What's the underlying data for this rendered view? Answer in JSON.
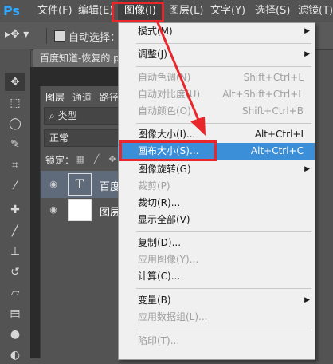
{
  "app": {
    "logo": "Ps"
  },
  "menubar": {
    "items": [
      {
        "label": "文件(F)"
      },
      {
        "label": "编辑(E)"
      },
      {
        "label": "图像(I)"
      },
      {
        "label": "图层(L)"
      },
      {
        "label": "文字(Y)"
      },
      {
        "label": "选择(S)"
      },
      {
        "label": "滤镜(T)"
      }
    ]
  },
  "options_bar": {
    "auto_select_label": "自动选择："
  },
  "document": {
    "tab_title": "百度知道-恢复的.p"
  },
  "layers_panel": {
    "tabs": [
      "图层",
      "通道",
      "路径"
    ],
    "filter_label": "类型",
    "blend_mode": "正常",
    "lock_label": "锁定：",
    "layers": [
      {
        "thumb_text": "T",
        "name": "百度"
      },
      {
        "name": "图层"
      }
    ]
  },
  "dropdown": {
    "items": [
      {
        "label": "模式(M)",
        "shortcut": "",
        "submenu": true,
        "disabled": false
      },
      {
        "label": "调整(J)",
        "shortcut": "",
        "submenu": true,
        "disabled": false
      },
      {
        "label": "自动色调(N)",
        "shortcut": "Shift+Ctrl+L",
        "submenu": false,
        "disabled": true
      },
      {
        "label": "自动对比度(U)",
        "shortcut": "Alt+Shift+Ctrl+L",
        "submenu": false,
        "disabled": true
      },
      {
        "label": "自动颜色(O)",
        "shortcut": "Shift+Ctrl+B",
        "submenu": false,
        "disabled": true
      },
      {
        "label": "图像大小(I)...",
        "shortcut": "Alt+Ctrl+I",
        "submenu": false,
        "disabled": false
      },
      {
        "label": "画布大小(S)...",
        "shortcut": "Alt+Ctrl+C",
        "submenu": false,
        "disabled": false,
        "highlighted": true
      },
      {
        "label": "图像旋转(G)",
        "shortcut": "",
        "submenu": true,
        "disabled": false
      },
      {
        "label": "裁剪(P)",
        "shortcut": "",
        "submenu": false,
        "disabled": true
      },
      {
        "label": "裁切(R)...",
        "shortcut": "",
        "submenu": false,
        "disabled": false
      },
      {
        "label": "显示全部(V)",
        "shortcut": "",
        "submenu": false,
        "disabled": false
      },
      {
        "label": "复制(D)...",
        "shortcut": "",
        "submenu": false,
        "disabled": false
      },
      {
        "label": "应用图像(Y)...",
        "shortcut": "",
        "submenu": false,
        "disabled": true
      },
      {
        "label": "计算(C)...",
        "shortcut": "",
        "submenu": false,
        "disabled": false
      },
      {
        "label": "变量(B)",
        "shortcut": "",
        "submenu": true,
        "disabled": false
      },
      {
        "label": "应用数据组(L)...",
        "shortcut": "",
        "submenu": false,
        "disabled": true
      },
      {
        "label": "陷印(T)...",
        "shortcut": "",
        "submenu": false,
        "disabled": true
      }
    ],
    "submenu_arrow": "▶"
  },
  "colors": {
    "highlight": "#3b8fd8",
    "callout": "#e8262b",
    "ps_blue": "#31a8ff"
  },
  "icons": {
    "move_tool": "move-icon",
    "marquee_tool": "marquee-icon",
    "lasso_tool": "lasso-icon",
    "quick_select_tool": "quick-select-icon",
    "crop_tool": "crop-icon",
    "eyedropper_tool": "eyedropper-icon",
    "healing_tool": "healing-icon",
    "brush_tool": "brush-icon",
    "stamp_tool": "stamp-icon",
    "history_brush_tool": "history-brush-icon",
    "eraser_tool": "eraser-icon",
    "gradient_tool": "gradient-icon",
    "blur_tool": "blur-icon",
    "dodge_tool": "dodge-icon"
  }
}
